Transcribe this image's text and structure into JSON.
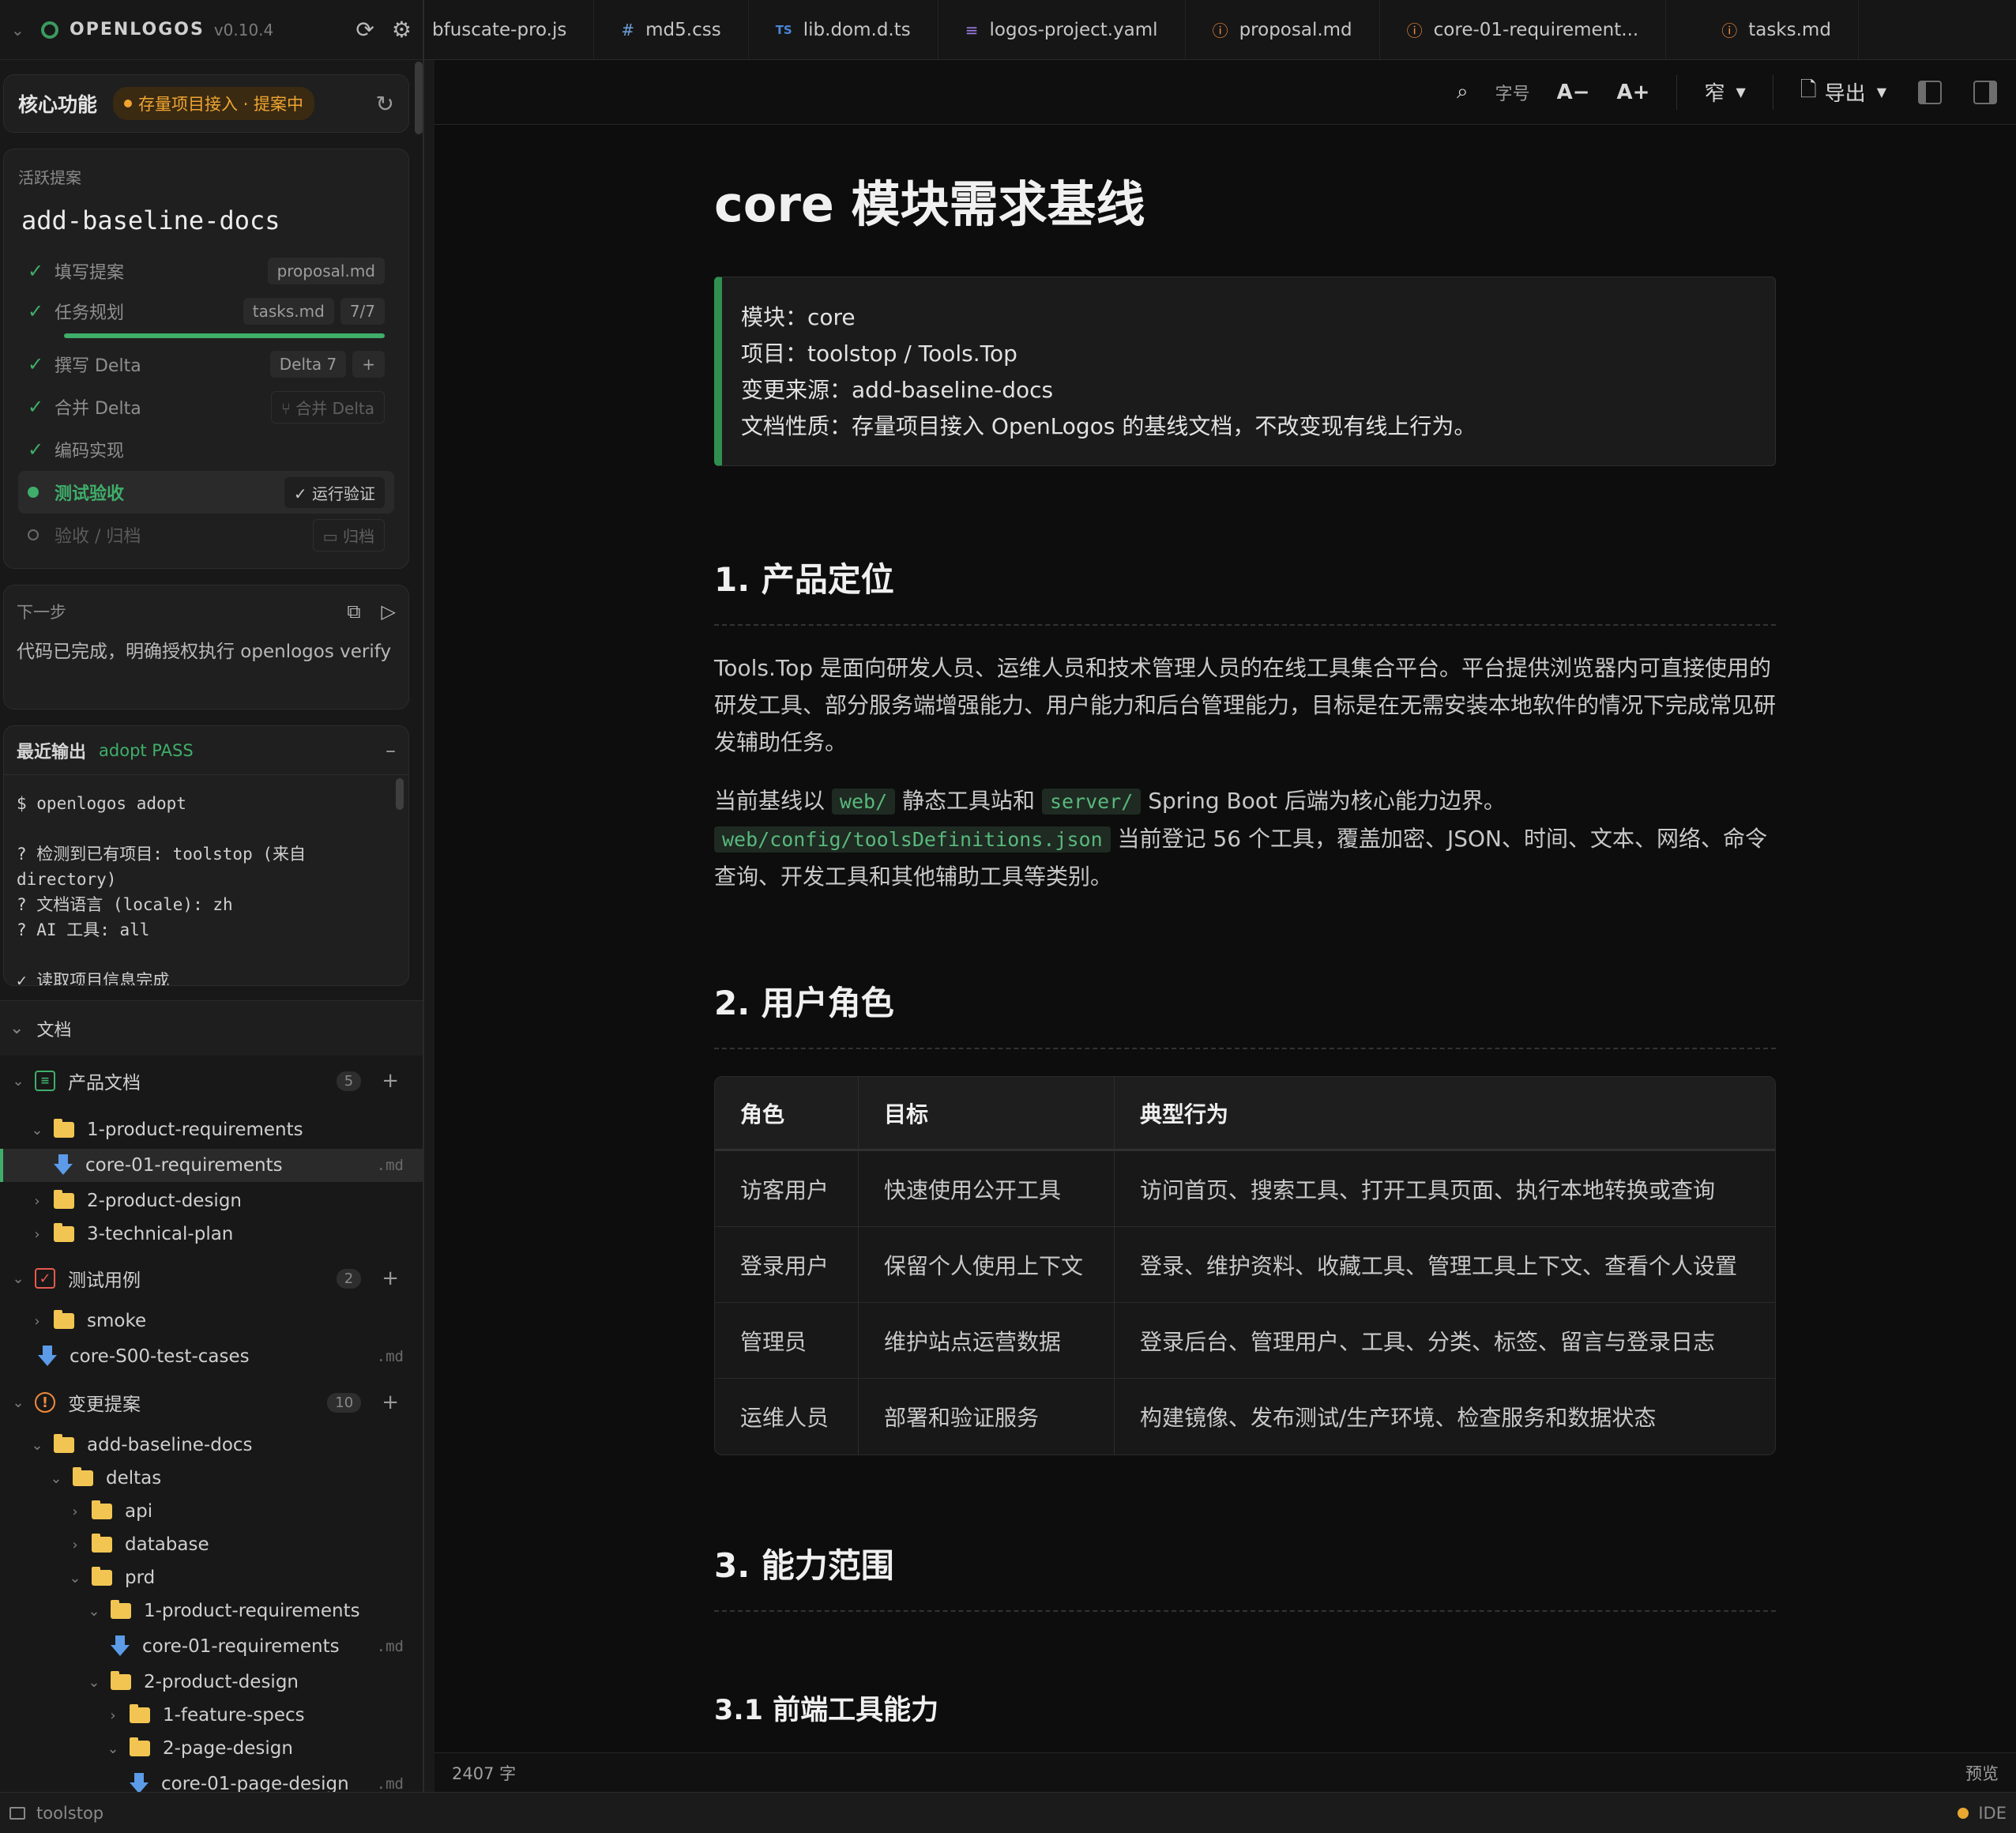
{
  "sidebar": {
    "brand": "OPENLOGOS",
    "version": "v0.10.4",
    "core": {
      "title": "核心功能",
      "badge": "存量项目接入 · 提案中"
    },
    "proposal": {
      "label": "活跃提案",
      "name": "add-baseline-docs",
      "steps": [
        {
          "label": "填写提案",
          "tag": "proposal.md"
        },
        {
          "label": "任务规划",
          "tag": "tasks.md",
          "count": "7/7"
        },
        {
          "label": "撰写 Delta",
          "tag": "Delta 7",
          "action": "+"
        },
        {
          "label": "合并 Delta",
          "tag": "合并 Delta"
        },
        {
          "label": "编码实现"
        },
        {
          "label": "测试验收",
          "tag": "运行验证"
        },
        {
          "label": "验收 / 归档",
          "tag": "归档"
        }
      ],
      "task_progress": 1.0
    },
    "next": {
      "label": "下一步",
      "message": "代码已完成，明确授权执行 openlogos verify"
    },
    "output": {
      "title": "最近输出",
      "status": "adopt PASS",
      "log": "$ openlogos adopt\n\n? 检测到已有项目: toolstop (来自 directory)\n? 文档语言 (locale): zh\n? AI 工具: all\n\n✓ 读取项目信息完成"
    },
    "docs_section": "文档",
    "tree": {
      "product_docs": {
        "label": "产品文档",
        "count": "5"
      },
      "pr1": "1-product-requirements",
      "core01": "core-01-requirements",
      "pd2": "2-product-design",
      "tp3": "3-technical-plan",
      "test_cases": {
        "label": "测试用例",
        "count": "2"
      },
      "smoke": "smoke",
      "s00": "core-S00-test-cases",
      "proposals": {
        "label": "变更提案",
        "count": "10"
      },
      "abd": "add-baseline-docs",
      "deltas": "deltas",
      "api": "api",
      "database": "database",
      "prd": "prd",
      "pr1b": "1-product-requirements",
      "core01b": "core-01-requirements",
      "pd2b": "2-product-design",
      "fs1": "1-feature-specs",
      "pgd2": "2-page-design",
      "pgd01": "core-01-page-design",
      "ext": ".md"
    }
  },
  "tabs": [
    {
      "label": "bfuscate-pro.js",
      "icon": ""
    },
    {
      "label": "md5.css",
      "icon": "#"
    },
    {
      "label": "lib.dom.d.ts",
      "icon": "TS"
    },
    {
      "label": "logos-project.yaml",
      "icon": "≡"
    },
    {
      "label": "proposal.md",
      "icon": "!"
    },
    {
      "label": "core-01-requirement...",
      "icon": "!"
    },
    {
      "label": "tasks.md",
      "icon": "!"
    }
  ],
  "toolbar": {
    "font_label": "字号",
    "font_dec": "A−",
    "font_inc": "A+",
    "width": "窄",
    "export": "导出"
  },
  "doc": {
    "title": "core 模块需求基线",
    "callout": [
      "模块：core",
      "项目：toolstop / Tools.Top",
      "变更来源：add-baseline-docs",
      "文档性质：存量项目接入 OpenLogos 的基线文档，不改变现有线上行为。"
    ],
    "h_positioning": "1. 产品定位",
    "p1": "Tools.Top 是面向研发人员、运维人员和技术管理人员的在线工具集合平台。平台提供浏览器内可直接使用的研发工具、部分服务端增强能力、用户能力和后台管理能力，目标是在无需安装本地软件的情况下完成常见研发辅助任务。",
    "p2_a": "当前基线以",
    "p2_code1": "web/",
    "p2_b": "静态工具站和",
    "p2_code2": "server/",
    "p2_c": "Spring Boot 后端为核心能力边界。",
    "p2_code3": "web/config/toolsDefinitions.json",
    "p2_d": "当前登记 56 个工具，覆盖加密、JSON、时间、文本、网络、命令查询、开发工具和其他辅助工具等类别。",
    "h_roles": "2. 用户角色",
    "table": {
      "headers": [
        "角色",
        "目标",
        "典型行为"
      ],
      "rows": [
        [
          "访客用户",
          "快速使用公开工具",
          "访问首页、搜索工具、打开工具页面、执行本地转换或查询"
        ],
        [
          "登录用户",
          "保留个人使用上下文",
          "登录、维护资料、收藏工具、管理工具上下文、查看个人设置"
        ],
        [
          "管理员",
          "维护站点运营数据",
          "登录后台、管理用户、工具、分类、标签、留言与登录日志"
        ],
        [
          "运维人员",
          "部署和验证服务",
          "构建镜像、发布测试/生产环境、检查服务和数据状态"
        ]
      ]
    },
    "h_scope": "3. 能力范围",
    "h_frontend": "3.1 前端工具能力"
  },
  "status": {
    "word_count": "2407 字",
    "preview": "预览",
    "project": "toolstop",
    "ide": "IDE"
  }
}
